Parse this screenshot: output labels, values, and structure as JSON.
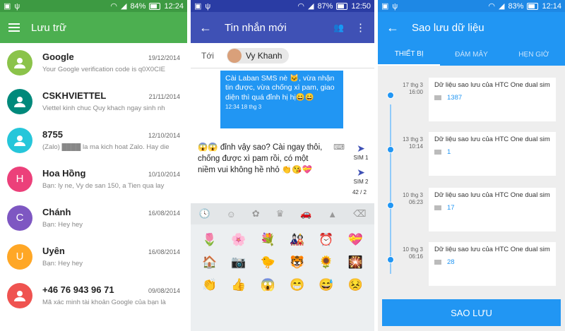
{
  "panel1": {
    "status": {
      "battery": "84%",
      "time": "12:24"
    },
    "title": "Lưu trữ",
    "conversations": [
      {
        "name": "Google",
        "date": "19/12/2014",
        "snippet": "Your Google verification code is q0X0CIE",
        "initial": "",
        "color": "#8bc34a"
      },
      {
        "name": "CSKHVIETTEL",
        "date": "21/11/2014",
        "snippet": "Viettel kinh chuc Quy khach ngay sinh nh",
        "initial": "",
        "color": "#00897b"
      },
      {
        "name": "8755",
        "date": "12/10/2014",
        "snippet": "(Zalo) ████ la ma kich hoat Zalo. Hay die",
        "initial": "",
        "color": "#26c6da"
      },
      {
        "name": "Hoa Hồng",
        "date": "10/10/2014",
        "snippet": "Bạn: ly ne,  Vy de san 150, a Tien qua lay",
        "initial": "H",
        "color": "#ec407a"
      },
      {
        "name": "Chánh",
        "date": "16/08/2014",
        "snippet": "Bạn: Hey hey",
        "initial": "C",
        "color": "#7e57c2"
      },
      {
        "name": "Uyên",
        "date": "16/08/2014",
        "snippet": "Bạn: Hey hey",
        "initial": "U",
        "color": "#ffa726"
      },
      {
        "name": "+46 76 943 96 71",
        "date": "09/08/2014",
        "snippet": "Mã xác minh tài khoản Google của bạn là",
        "initial": "",
        "color": "#ef5350"
      }
    ]
  },
  "panel2": {
    "status": {
      "battery": "87%",
      "time": "12:50"
    },
    "title": "Tin nhắn mới",
    "to_label": "Tới",
    "recipient": "Vy Khanh",
    "sent_message": "Cài Laban SMS nè 🐱, vừa nhận tin được, vừa chống xì pam, giao diện thì quá đỉnh hị hị😄😄",
    "sent_time": "12:34 18 thg 3",
    "draft": "😱😱 đỉnh vậy sao? Cài ngay thôi, chống được xì pam rồi, có một niềm vui không hề nhỏ 👏😘💝",
    "sim1": "SIM 1",
    "sim2": "SIM 2",
    "counter": "42 / 2",
    "kb_tabs": [
      "🕓",
      "☺",
      "✿",
      "♛",
      "🚗",
      "▲",
      "⌫"
    ],
    "emojis": [
      "🌷",
      "🌸",
      "💐",
      "🎎",
      "⏰",
      "💝",
      "🏠",
      "📷",
      "🐤",
      "🐯",
      "🌻",
      "🎇",
      "👏",
      "👍",
      "😱",
      "😁",
      "😅",
      "😣"
    ]
  },
  "panel3": {
    "status": {
      "battery": "83%",
      "time": "12:14"
    },
    "title": "Sao lưu dữ liệu",
    "tabs": [
      "THIẾT BỊ",
      "ĐÁM MÂY",
      "HẸN GIỜ"
    ],
    "backups": [
      {
        "date": "17 thg 3",
        "time": "16:00",
        "title": "Dữ liệu sao lưu của HTC One dual sim",
        "count": "1387"
      },
      {
        "date": "13 thg 3",
        "time": "10:14",
        "title": "Dữ liệu sao lưu của HTC One dual sim",
        "count": "1"
      },
      {
        "date": "10 thg 3",
        "time": "06:23",
        "title": "Dữ liệu sao lưu của HTC One dual sim",
        "count": "17"
      },
      {
        "date": "10 thg 3",
        "time": "06:16",
        "title": "Dữ liệu sao lưu của HTC One dual sim",
        "count": "28"
      }
    ],
    "save_label": "SAO LƯU"
  }
}
